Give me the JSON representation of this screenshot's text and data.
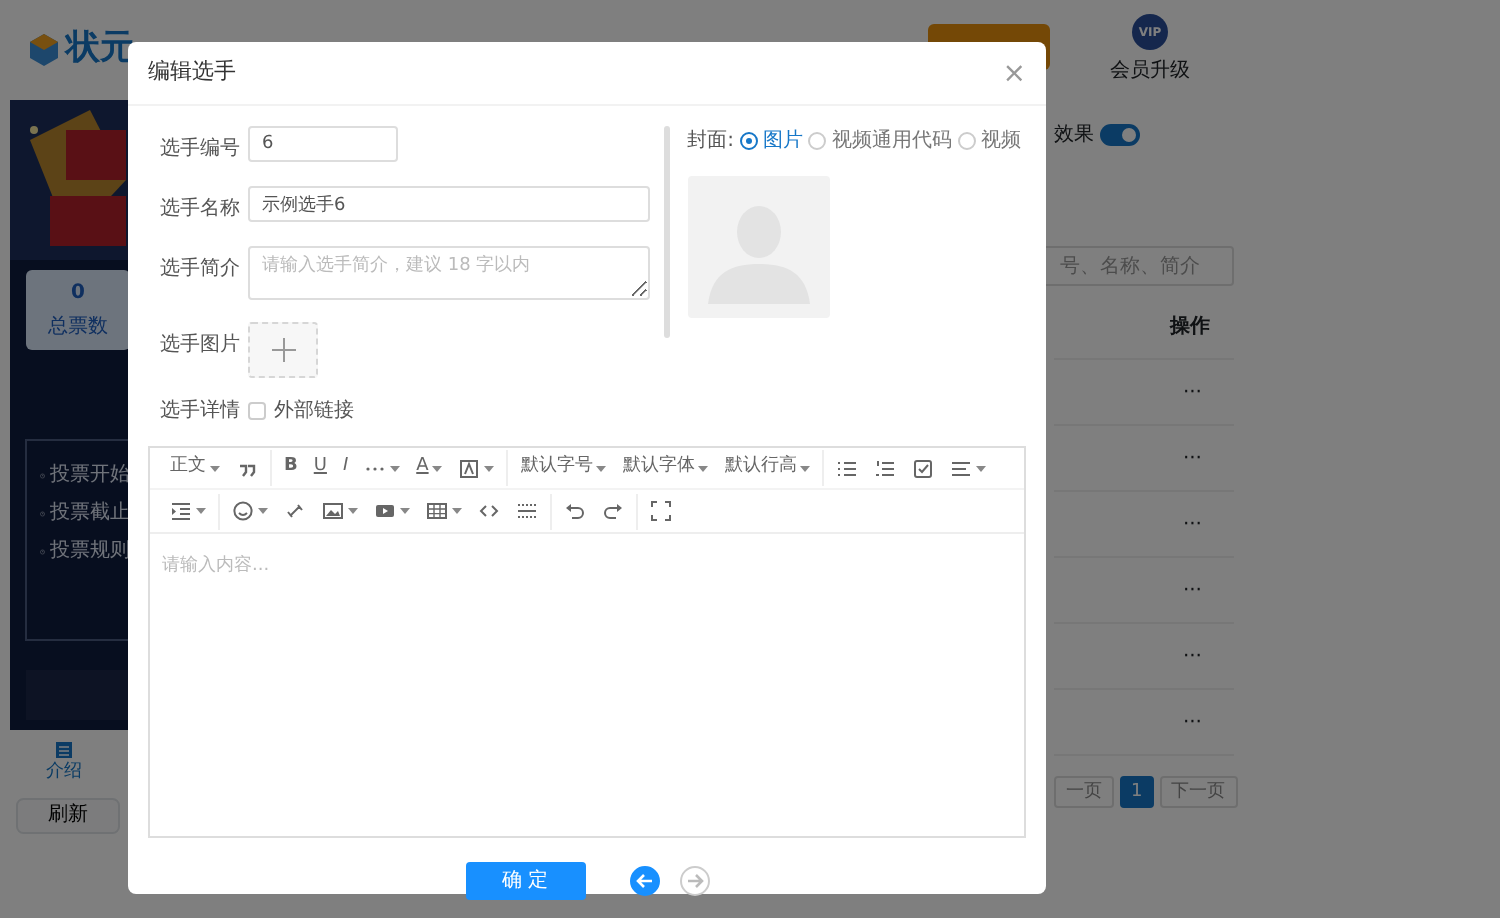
{
  "header": {
    "logo": "状元",
    "vip_badge": "VIP",
    "member_upgrade": "会员升级"
  },
  "poster": {
    "stat_value": "0",
    "stat_label": "总票数",
    "info": [
      "投票开始",
      "投票截止",
      "投票规则"
    ],
    "tab": "介绍",
    "refresh": "刷新"
  },
  "panel": {
    "toggle_label": "效果",
    "toggle_on": true,
    "search_placeholder": "号、名称、简介",
    "column": "操作",
    "rows": [
      "···",
      "···",
      "···",
      "···",
      "···",
      "···"
    ],
    "pages": [
      {
        "label": "一页",
        "selected": false
      },
      {
        "label": "1",
        "selected": true
      },
      {
        "label": "下一页",
        "selected": false
      }
    ]
  },
  "dialog": {
    "title": "编辑选手",
    "close": "×",
    "fields": [
      {
        "kind": "short_input",
        "label": "选手编号",
        "value": "6"
      },
      {
        "kind": "input",
        "label": "选手名称",
        "value": "示例选手6"
      },
      {
        "kind": "textarea",
        "label": "选手简介",
        "placeholder": "请输入选手简介，建议 18 字以内"
      },
      {
        "kind": "upload",
        "label": "选手图片"
      },
      {
        "kind": "checkbox",
        "label": "选手详情",
        "option": "外部链接",
        "checked": false
      }
    ],
    "cover": {
      "label": "封面:",
      "options": [
        {
          "label": "图片",
          "selected": true
        },
        {
          "label": "视频通用代码",
          "selected": false
        },
        {
          "label": "视频",
          "selected": false
        }
      ]
    },
    "toolbar": [
      [
        {
          "kind": "text",
          "label": "正文",
          "dropdown": true
        },
        {
          "kind": "icon",
          "dropdown": false
        },
        {
          "kind": "text",
          "label": "B",
          "dropdown": false
        },
        {
          "kind": "text",
          "label": "U",
          "dropdown": false
        },
        {
          "kind": "text",
          "label": "I",
          "dropdown": false
        },
        {
          "kind": "icon",
          "dropdown": true
        },
        {
          "kind": "text",
          "label": "A",
          "dropdown": true
        },
        {
          "kind": "icon",
          "dropdown": true
        },
        {
          "kind": "text",
          "label": "默认字号",
          "dropdown": true
        },
        {
          "kind": "text",
          "label": "默认字体",
          "dropdown": true
        },
        {
          "kind": "text",
          "label": "默认行高",
          "dropdown": true
        },
        {
          "kind": "icon",
          "dropdown": false
        },
        {
          "kind": "icon",
          "dropdown": false
        },
        {
          "kind": "icon",
          "dropdown": false
        },
        {
          "kind": "icon",
          "dropdown": true
        }
      ],
      [
        {
          "kind": "icon",
          "dropdown": true
        },
        {
          "kind": "icon",
          "dropdown": true
        },
        {
          "kind": "icon",
          "dropdown": false
        },
        {
          "kind": "icon",
          "dropdown": true
        },
        {
          "kind": "icon",
          "dropdown": true
        },
        {
          "kind": "icon",
          "dropdown": true
        },
        {
          "kind": "icon",
          "dropdown": false
        },
        {
          "kind": "icon",
          "dropdown": false
        },
        {
          "kind": "icon",
          "dropdown": false
        },
        {
          "kind": "icon",
          "dropdown": false
        },
        {
          "kind": "icon",
          "dropdown": false
        }
      ]
    ],
    "editor_placeholder": "请输入内容...",
    "confirm": "确 定",
    "prev_disabled": false,
    "next_disabled": true
  }
}
